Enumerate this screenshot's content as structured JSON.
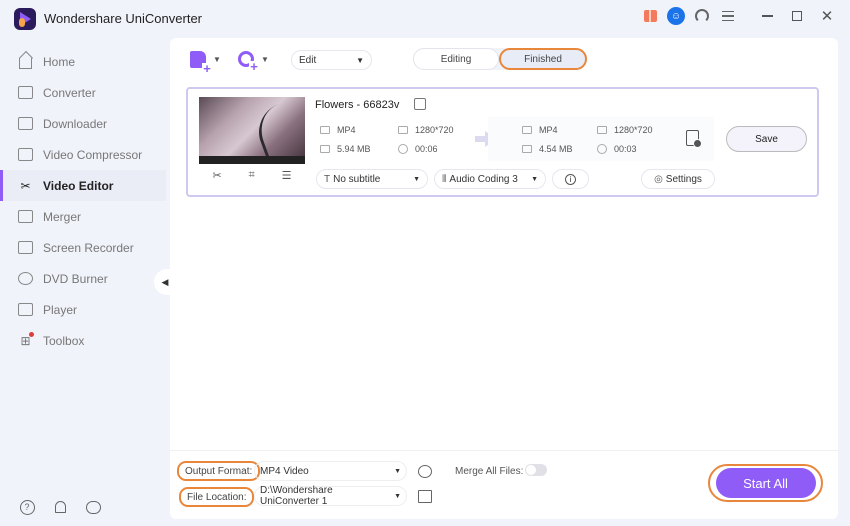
{
  "app": {
    "title": "Wondershare UniConverter"
  },
  "titlebar": {
    "icons": [
      "gift-icon",
      "user-icon",
      "headset-icon",
      "menu-icon"
    ],
    "window_controls": [
      "minimize",
      "maximize",
      "close"
    ],
    "close_glyph": "✕"
  },
  "sidebar": {
    "items": [
      {
        "label": "Home",
        "icon": "home-icon",
        "active": false
      },
      {
        "label": "Converter",
        "icon": "converter-icon",
        "active": false
      },
      {
        "label": "Downloader",
        "icon": "downloader-icon",
        "active": false
      },
      {
        "label": "Video Compressor",
        "icon": "compressor-icon",
        "active": false
      },
      {
        "label": "Video Editor",
        "icon": "scissors-icon",
        "active": true
      },
      {
        "label": "Merger",
        "icon": "merger-icon",
        "active": false
      },
      {
        "label": "Screen Recorder",
        "icon": "screen-recorder-icon",
        "active": false
      },
      {
        "label": "DVD Burner",
        "icon": "dvd-icon",
        "active": false
      },
      {
        "label": "Player",
        "icon": "player-icon",
        "active": false
      },
      {
        "label": "Toolbox",
        "icon": "toolbox-icon",
        "active": false,
        "badge": true
      }
    ],
    "bottom_icons": [
      "help-icon",
      "bell-icon",
      "feedback-icon"
    ],
    "help_glyph": "?"
  },
  "toolbar": {
    "edit_select": {
      "value": "Edit"
    },
    "tabs": [
      {
        "label": "Editing",
        "selected": false
      },
      {
        "label": "Finished",
        "selected": true
      }
    ]
  },
  "file": {
    "title": "Flowers - 66823v",
    "source": {
      "format": "MP4",
      "size": "5.94 MB",
      "resolution": "1280*720",
      "duration": "00:06"
    },
    "output": {
      "format": "MP4",
      "size": "4.54 MB",
      "resolution": "1280*720",
      "duration": "00:03"
    },
    "save_label": "Save",
    "subtitle": {
      "value": "No subtitle"
    },
    "audio": {
      "value": "Audio Coding 3"
    },
    "settings_label": "Settings",
    "thumb_tools": [
      "✂",
      "⌗",
      "☰"
    ]
  },
  "bottom": {
    "output_format_label": "Output Format:",
    "output_format_value": "MP4 Video",
    "file_location_label": "File Location:",
    "file_location_value": "D:\\Wondershare UniConverter 1",
    "merge_label": "Merge All Files:",
    "merge_enabled": false,
    "start_all_label": "Start All"
  },
  "colors": {
    "accent": "#8f5cf7",
    "highlight": "#e8873c"
  }
}
